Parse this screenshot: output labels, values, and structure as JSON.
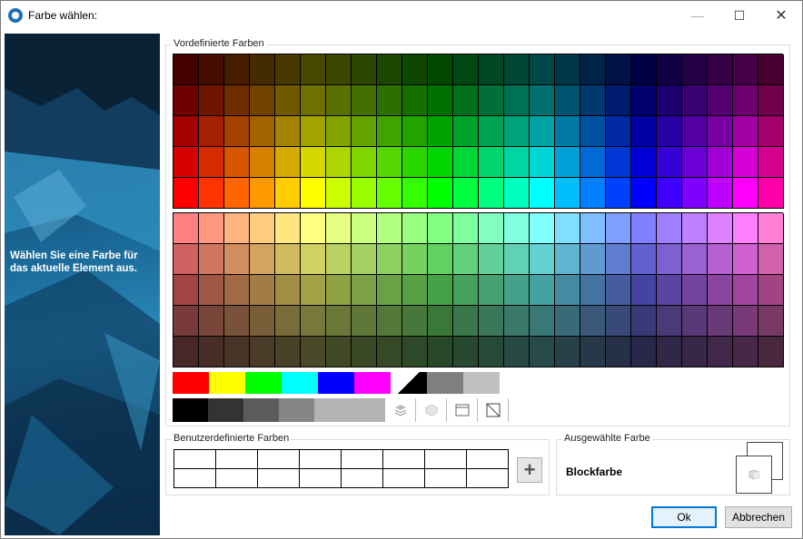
{
  "window": {
    "title": "Farbe wählen:",
    "min_symbol": "—",
    "max_symbol": "☐",
    "close_symbol": "✕"
  },
  "sidebar": {
    "text": "Wählen Sie eine Farbe für das aktuelle Element aus.",
    "help_symbol": "?"
  },
  "predefined": {
    "label": "Vordefinierte Farben",
    "hues": [
      0,
      12,
      24,
      36,
      48,
      60,
      72,
      84,
      96,
      108,
      120,
      135,
      150,
      165,
      180,
      195,
      210,
      225,
      240,
      255,
      270,
      285,
      300,
      320,
      345
    ],
    "top_block_rows": [
      {
        "l": 14
      },
      {
        "l": 22
      },
      {
        "l": 32
      },
      {
        "l": 42
      },
      {
        "l": 50
      }
    ],
    "bottom_block_rows": [
      {
        "s": 100,
        "l": 75
      },
      {
        "s": 55,
        "l": 60
      },
      {
        "s": 40,
        "l": 45
      },
      {
        "s": 35,
        "l": 35
      },
      {
        "s": 30,
        "l": 22
      }
    ],
    "bright_colors": [
      "#ff0000",
      "#ffff00",
      "#00ff00",
      "#00ffff",
      "#0000ff",
      "#ff00ff",
      "transparent",
      "#808080",
      "#c0c0c0"
    ],
    "grays": [
      "#000000",
      "#333333",
      "#5c5c5c",
      "#858585",
      "#b3b3b3",
      "#b3b3b3"
    ],
    "tool_icons": [
      "layers-icon",
      "cube-icon",
      "window-icon",
      "no-color-icon"
    ]
  },
  "custom": {
    "label": "Benutzerdefinierte Farben",
    "add_symbol": "+",
    "cell_count": 16
  },
  "selected": {
    "label": "Ausgewählte Farbe",
    "name": "Blockfarbe"
  },
  "buttons": {
    "ok": "Ok",
    "cancel": "Abbrechen"
  }
}
